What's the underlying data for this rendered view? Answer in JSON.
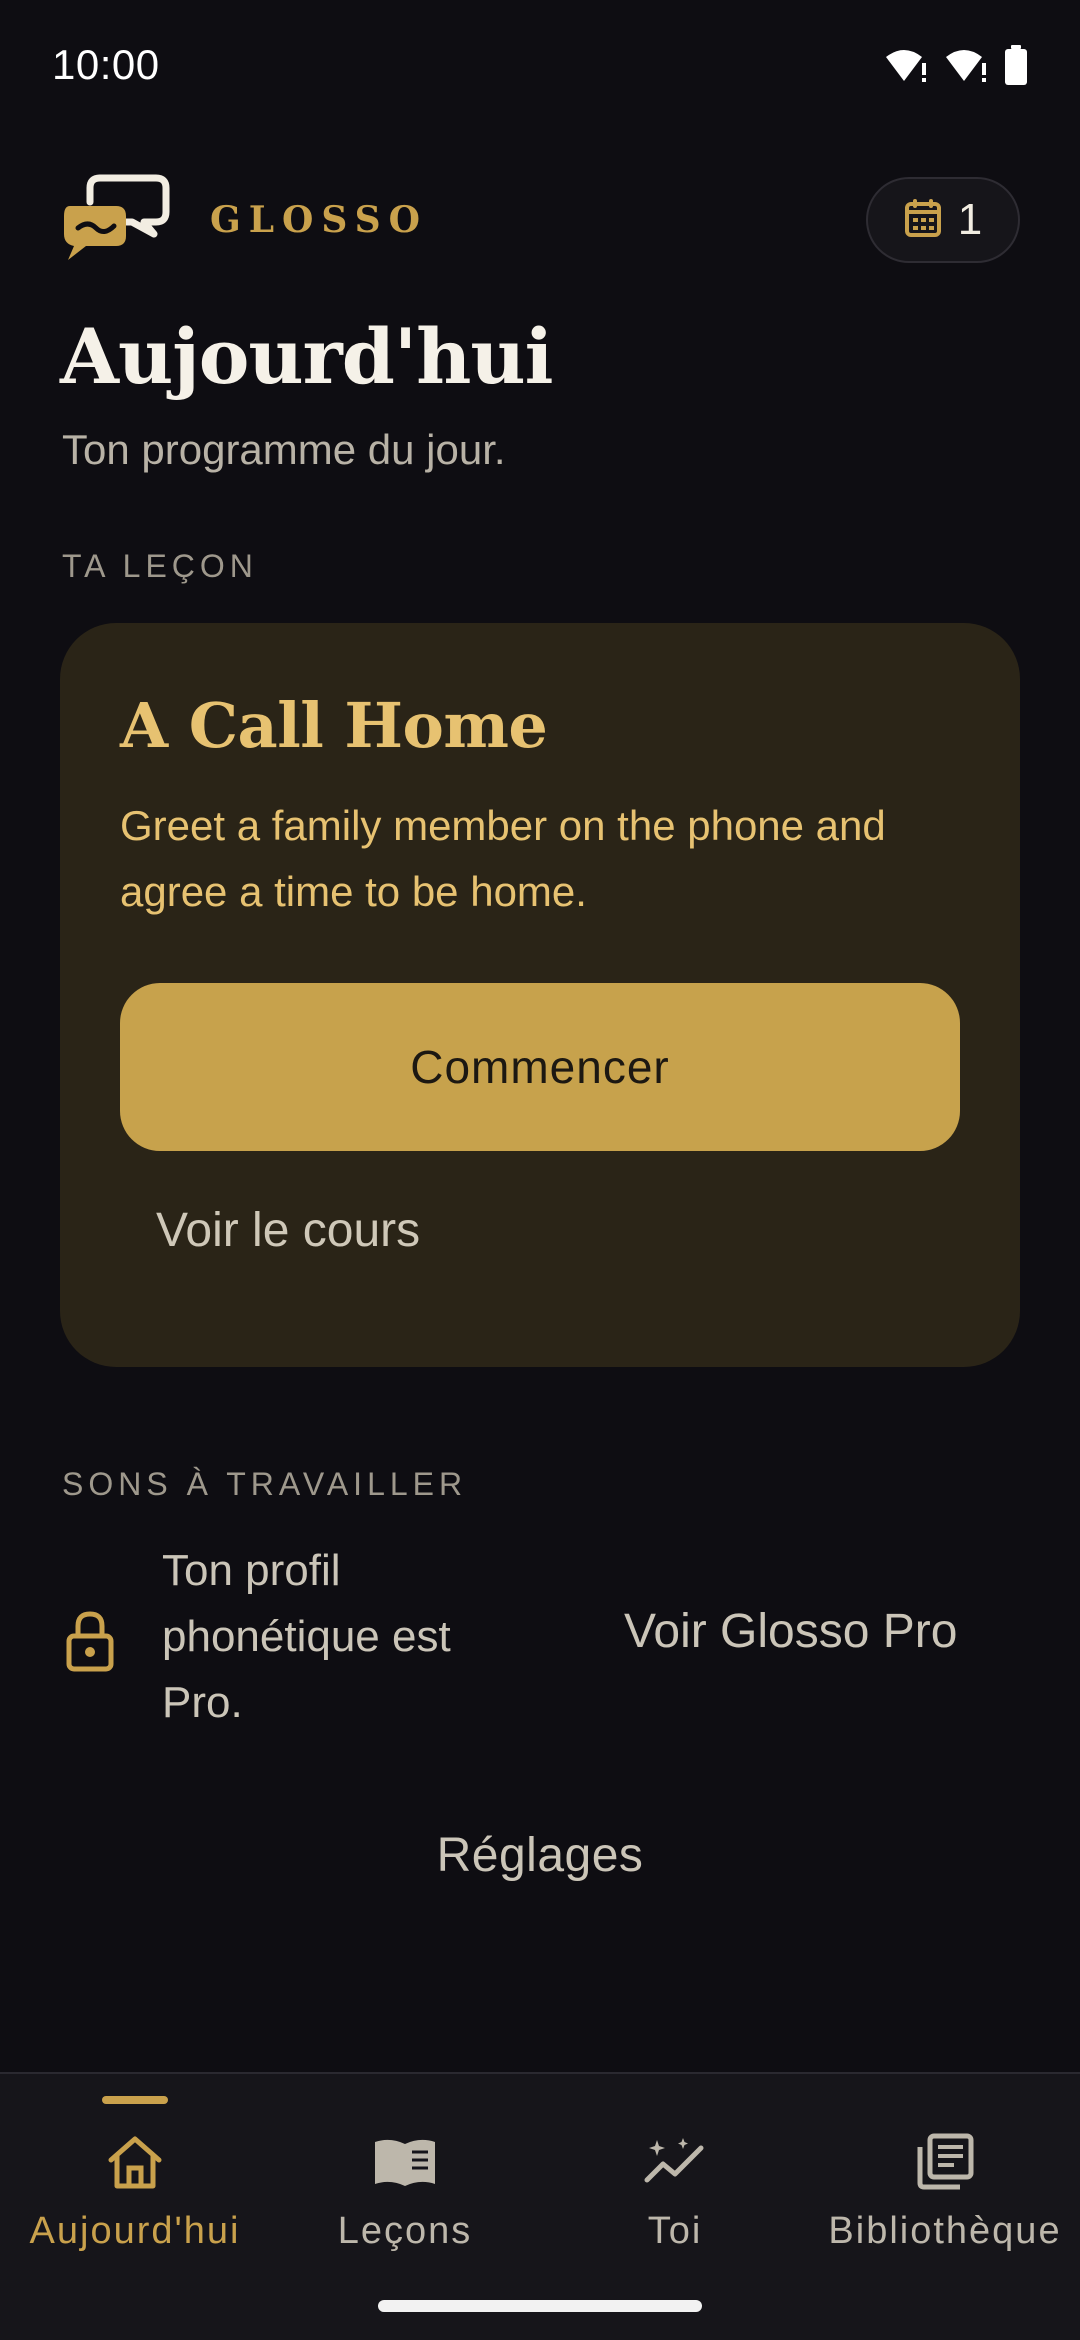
{
  "status_bar": {
    "time": "10:00",
    "icons": [
      "wifi-alert-icon",
      "wifi-alert-icon",
      "battery-icon"
    ]
  },
  "header": {
    "brand_name": "GLOSSO",
    "logo_icon": "speech-bubbles-logo",
    "streak_icon": "calendar-icon",
    "streak_count": "1"
  },
  "page": {
    "title": "Aujourd'hui",
    "subtitle": "Ton programme du jour."
  },
  "lesson_section": {
    "label": "TA LEÇON",
    "card": {
      "title": "A Call Home",
      "description": "Greet a family member on the phone and agree a time to be home.",
      "start_label": "Commencer",
      "view_course_label": "Voir le cours"
    }
  },
  "sounds_section": {
    "label": "SONS À TRAVAILLER",
    "locked_text": "Ton profil phonétique est Pro.",
    "lock_icon": "lock-icon",
    "pro_link_label": "Voir Glosso Pro"
  },
  "settings_label": "Réglages",
  "bottom_nav": {
    "items": [
      {
        "label": "Aujourd'hui",
        "icon": "home-icon",
        "active": true
      },
      {
        "label": "Leçons",
        "icon": "book-icon",
        "active": false
      },
      {
        "label": "Toi",
        "icon": "sparkle-chart-icon",
        "active": false
      },
      {
        "label": "Bibliothèque",
        "icon": "library-icon",
        "active": false
      }
    ]
  },
  "colors": {
    "background": "#0e0d12",
    "accent": "#c9a14c",
    "card_background": "#2a2417",
    "card_text": "#e7c271",
    "button": "#c7a24c"
  }
}
